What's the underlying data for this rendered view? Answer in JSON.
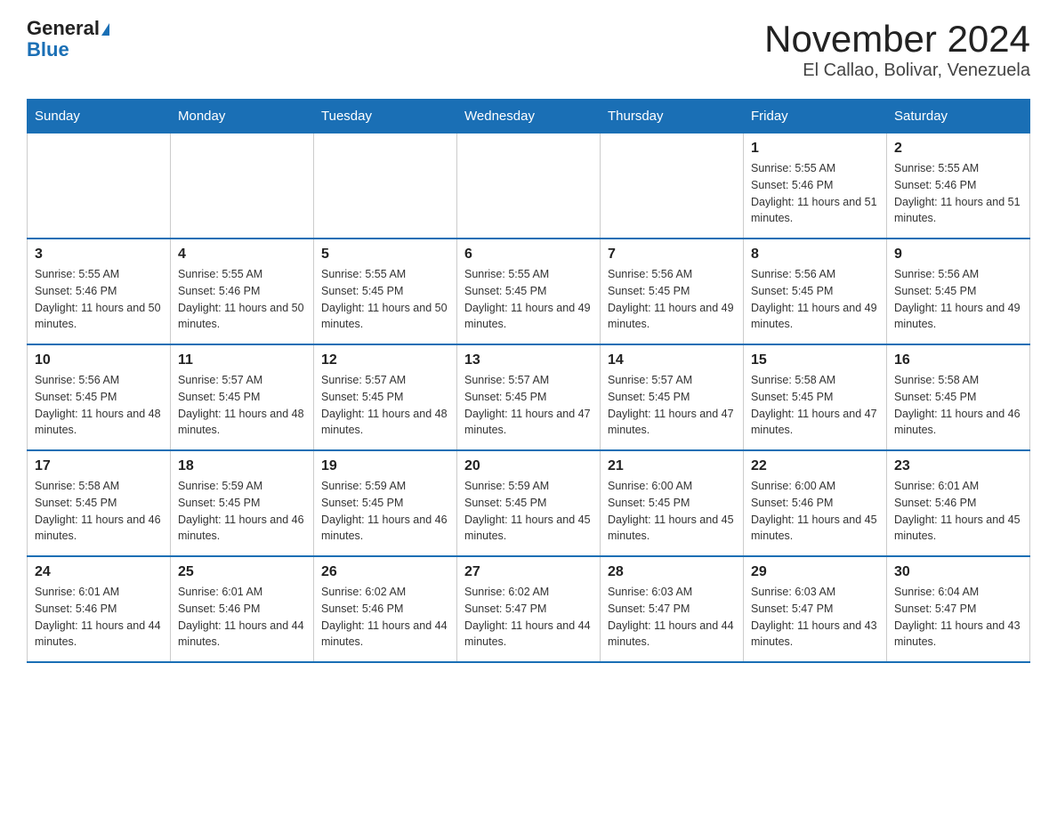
{
  "logo": {
    "general": "General",
    "blue": "Blue"
  },
  "title": "November 2024",
  "location": "El Callao, Bolivar, Venezuela",
  "days_of_week": [
    "Sunday",
    "Monday",
    "Tuesday",
    "Wednesday",
    "Thursday",
    "Friday",
    "Saturday"
  ],
  "weeks": [
    [
      {
        "day": "",
        "info": ""
      },
      {
        "day": "",
        "info": ""
      },
      {
        "day": "",
        "info": ""
      },
      {
        "day": "",
        "info": ""
      },
      {
        "day": "",
        "info": ""
      },
      {
        "day": "1",
        "info": "Sunrise: 5:55 AM\nSunset: 5:46 PM\nDaylight: 11 hours and 51 minutes."
      },
      {
        "day": "2",
        "info": "Sunrise: 5:55 AM\nSunset: 5:46 PM\nDaylight: 11 hours and 51 minutes."
      }
    ],
    [
      {
        "day": "3",
        "info": "Sunrise: 5:55 AM\nSunset: 5:46 PM\nDaylight: 11 hours and 50 minutes."
      },
      {
        "day": "4",
        "info": "Sunrise: 5:55 AM\nSunset: 5:46 PM\nDaylight: 11 hours and 50 minutes."
      },
      {
        "day": "5",
        "info": "Sunrise: 5:55 AM\nSunset: 5:45 PM\nDaylight: 11 hours and 50 minutes."
      },
      {
        "day": "6",
        "info": "Sunrise: 5:55 AM\nSunset: 5:45 PM\nDaylight: 11 hours and 49 minutes."
      },
      {
        "day": "7",
        "info": "Sunrise: 5:56 AM\nSunset: 5:45 PM\nDaylight: 11 hours and 49 minutes."
      },
      {
        "day": "8",
        "info": "Sunrise: 5:56 AM\nSunset: 5:45 PM\nDaylight: 11 hours and 49 minutes."
      },
      {
        "day": "9",
        "info": "Sunrise: 5:56 AM\nSunset: 5:45 PM\nDaylight: 11 hours and 49 minutes."
      }
    ],
    [
      {
        "day": "10",
        "info": "Sunrise: 5:56 AM\nSunset: 5:45 PM\nDaylight: 11 hours and 48 minutes."
      },
      {
        "day": "11",
        "info": "Sunrise: 5:57 AM\nSunset: 5:45 PM\nDaylight: 11 hours and 48 minutes."
      },
      {
        "day": "12",
        "info": "Sunrise: 5:57 AM\nSunset: 5:45 PM\nDaylight: 11 hours and 48 minutes."
      },
      {
        "day": "13",
        "info": "Sunrise: 5:57 AM\nSunset: 5:45 PM\nDaylight: 11 hours and 47 minutes."
      },
      {
        "day": "14",
        "info": "Sunrise: 5:57 AM\nSunset: 5:45 PM\nDaylight: 11 hours and 47 minutes."
      },
      {
        "day": "15",
        "info": "Sunrise: 5:58 AM\nSunset: 5:45 PM\nDaylight: 11 hours and 47 minutes."
      },
      {
        "day": "16",
        "info": "Sunrise: 5:58 AM\nSunset: 5:45 PM\nDaylight: 11 hours and 46 minutes."
      }
    ],
    [
      {
        "day": "17",
        "info": "Sunrise: 5:58 AM\nSunset: 5:45 PM\nDaylight: 11 hours and 46 minutes."
      },
      {
        "day": "18",
        "info": "Sunrise: 5:59 AM\nSunset: 5:45 PM\nDaylight: 11 hours and 46 minutes."
      },
      {
        "day": "19",
        "info": "Sunrise: 5:59 AM\nSunset: 5:45 PM\nDaylight: 11 hours and 46 minutes."
      },
      {
        "day": "20",
        "info": "Sunrise: 5:59 AM\nSunset: 5:45 PM\nDaylight: 11 hours and 45 minutes."
      },
      {
        "day": "21",
        "info": "Sunrise: 6:00 AM\nSunset: 5:45 PM\nDaylight: 11 hours and 45 minutes."
      },
      {
        "day": "22",
        "info": "Sunrise: 6:00 AM\nSunset: 5:46 PM\nDaylight: 11 hours and 45 minutes."
      },
      {
        "day": "23",
        "info": "Sunrise: 6:01 AM\nSunset: 5:46 PM\nDaylight: 11 hours and 45 minutes."
      }
    ],
    [
      {
        "day": "24",
        "info": "Sunrise: 6:01 AM\nSunset: 5:46 PM\nDaylight: 11 hours and 44 minutes."
      },
      {
        "day": "25",
        "info": "Sunrise: 6:01 AM\nSunset: 5:46 PM\nDaylight: 11 hours and 44 minutes."
      },
      {
        "day": "26",
        "info": "Sunrise: 6:02 AM\nSunset: 5:46 PM\nDaylight: 11 hours and 44 minutes."
      },
      {
        "day": "27",
        "info": "Sunrise: 6:02 AM\nSunset: 5:47 PM\nDaylight: 11 hours and 44 minutes."
      },
      {
        "day": "28",
        "info": "Sunrise: 6:03 AM\nSunset: 5:47 PM\nDaylight: 11 hours and 44 minutes."
      },
      {
        "day": "29",
        "info": "Sunrise: 6:03 AM\nSunset: 5:47 PM\nDaylight: 11 hours and 43 minutes."
      },
      {
        "day": "30",
        "info": "Sunrise: 6:04 AM\nSunset: 5:47 PM\nDaylight: 11 hours and 43 minutes."
      }
    ]
  ]
}
